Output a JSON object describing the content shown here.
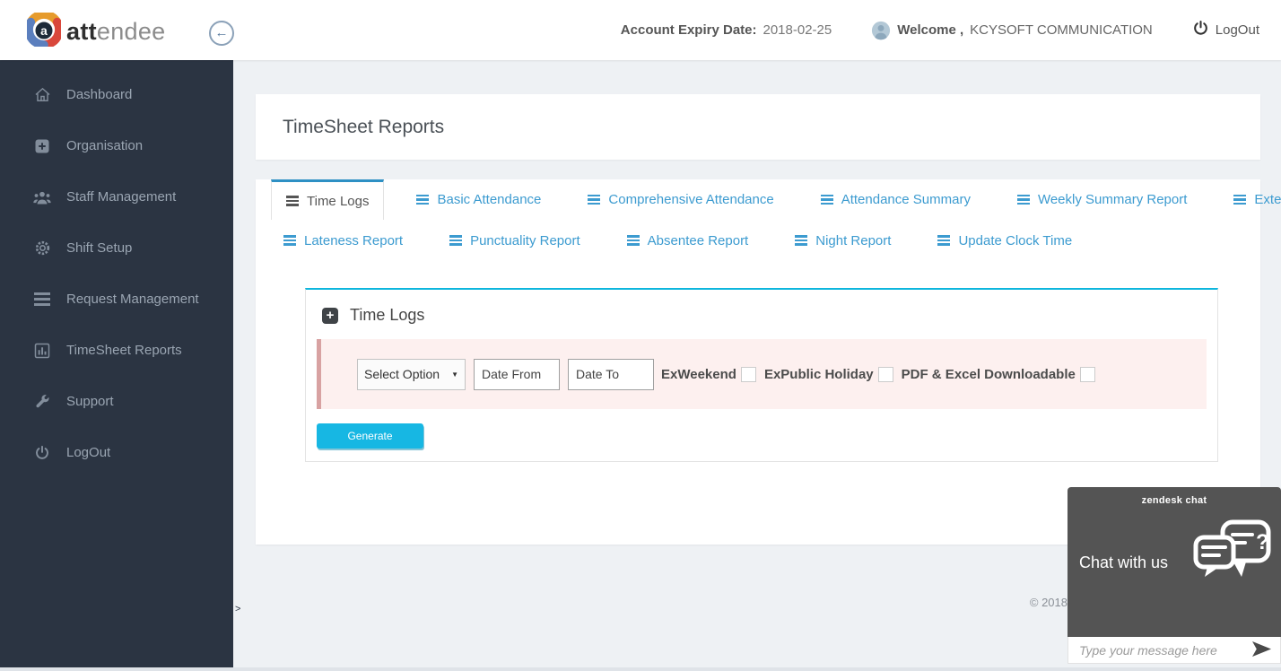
{
  "header": {
    "logo_bold": "att",
    "logo_light": "endee",
    "logo_letter": "a",
    "back_icon": "←",
    "account_expiry_label": "Account Expiry Date:",
    "account_expiry_value": "2018-02-25",
    "welcome_label": "Welcome ,",
    "company_name": "KCYSOFT COMMUNICATION",
    "logout_label": "LogOut"
  },
  "sidebar": {
    "items": [
      {
        "label": "Dashboard",
        "icon": "home-icon"
      },
      {
        "label": "Organisation",
        "icon": "plus-square-icon"
      },
      {
        "label": "Staff Management",
        "icon": "users-icon"
      },
      {
        "label": "Shift Setup",
        "icon": "gear-icon"
      },
      {
        "label": "Request Management",
        "icon": "list-icon"
      },
      {
        "label": "TimeSheet Reports",
        "icon": "bar-chart-icon"
      },
      {
        "label": "Support",
        "icon": "wrench-icon"
      },
      {
        "label": "LogOut",
        "icon": "power-icon"
      }
    ]
  },
  "main": {
    "page_title": "TimeSheet Reports",
    "tabs_row1": [
      {
        "label": "Time Logs",
        "active": true
      },
      {
        "label": "Basic Attendance",
        "active": false
      },
      {
        "label": "Comprehensive Attendance",
        "active": false
      },
      {
        "label": "Attendance Summary",
        "active": false
      },
      {
        "label": "Weekly Summary Report",
        "active": false
      },
      {
        "label": "Extended Report",
        "active": false
      }
    ],
    "tabs_row2": [
      {
        "label": "Lateness Report",
        "active": false
      },
      {
        "label": "Punctuality Report",
        "active": false
      },
      {
        "label": "Absentee Report",
        "active": false
      },
      {
        "label": "Night Report",
        "active": false
      },
      {
        "label": "Update Clock Time",
        "active": false
      }
    ],
    "panel": {
      "title": "Time Logs",
      "select_value": "Select Option",
      "select_arrow": "▼",
      "date_from_placeholder": "Date From",
      "date_to_placeholder": "Date To",
      "checkboxes": [
        {
          "label": "ExWeekend",
          "checked": false
        },
        {
          "label": "ExPublic Holiday",
          "checked": false
        },
        {
          "label": "PDF & Excel Downloadable",
          "checked": false
        }
      ],
      "generate_label": "Generate"
    },
    "footer_text": "© 2018",
    "stray_text": ">"
  },
  "chat_widget": {
    "brand": "zendesk chat",
    "headline": "Chat with us",
    "input_placeholder": "Type your message here",
    "icons": [
      "chat-bubbles-icon",
      "send-arrow-icon"
    ]
  },
  "colors": {
    "accent_cyan": "#17b7e3",
    "panel_top_border": "#0eb6dd",
    "tab_link_blue": "#3c9bd0",
    "active_tab_top_border": "#2e90c4",
    "sidebar_bg": "#2b3442",
    "header_bg": "#ffffff",
    "page_bg": "#eef1f4",
    "form_strip_bg": "#fdf0ef",
    "form_strip_border": "#d8a2a2",
    "chat_bg": "#545454",
    "logo_orange": "#e69b2c",
    "logo_blue": "#5b7fbe",
    "logo_red": "#d9473b"
  }
}
